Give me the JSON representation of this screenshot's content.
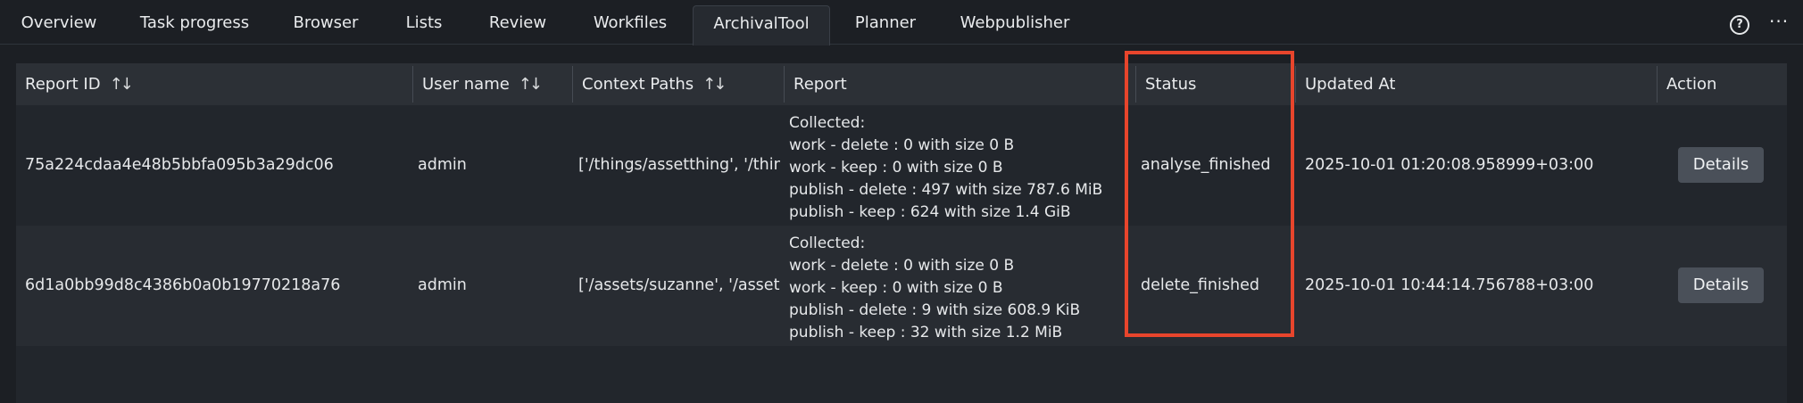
{
  "tabs": [
    {
      "label": "Overview"
    },
    {
      "label": "Task progress"
    },
    {
      "label": "Browser"
    },
    {
      "label": "Lists"
    },
    {
      "label": "Review"
    },
    {
      "label": "Workfiles"
    },
    {
      "label": "ArchivalTool",
      "active": true
    },
    {
      "label": "Planner"
    },
    {
      "label": "Webpublisher"
    }
  ],
  "toolbar": {
    "help_symbol": "?",
    "more_symbol": "···"
  },
  "icons": {
    "help": "help-icon",
    "more": "more-horizontal-icon",
    "sort": "sort-updown-icon"
  },
  "table": {
    "headers": {
      "report_id": "Report ID",
      "user_name": "User name",
      "context_paths": "Context Paths",
      "report": "Report",
      "status": "Status",
      "updated_at": "Updated At",
      "action": "Action"
    },
    "sort_symbol": "↑↓",
    "rows": [
      {
        "report_id": "75a224cdaa4e48b5bbfa095b3a29dc06",
        "user_name": "admin",
        "context_paths": "['/things/assetthing', '/thin...",
        "report": {
          "line1": "Collected:",
          "line2": "work - delete : 0 with size 0 B",
          "line3": "work - keep : 0 with size 0 B",
          "line4": "publish - delete : 497 with size 787.6 MiB",
          "line5": "publish - keep : 624 with size 1.4 GiB"
        },
        "status": "analyse_finished",
        "updated_at": "2025-10-01 01:20:08.958999+03:00",
        "action": "Details"
      },
      {
        "report_id": "6d1a0bb99d8c4386b0a0b19770218a76",
        "user_name": "admin",
        "context_paths": "['/assets/suzanne', '/assets...",
        "report": {
          "line1": "Collected:",
          "line2": "work - delete : 0 with size 0 B",
          "line3": "work - keep : 0 with size 0 B",
          "line4": "publish - delete : 9 with size 608.9 KiB",
          "line5": "publish - keep : 32 with size 1.2 MiB"
        },
        "status": "delete_finished",
        "updated_at": "2025-10-01 10:44:14.756788+03:00",
        "action": "Details"
      }
    ]
  },
  "colors": {
    "background": "#1c1f24",
    "header_bg": "#2c3036",
    "row_alt_bg": "#282c32",
    "button_bg": "#4a5059",
    "highlight": "#e8452c",
    "text": "#e6e8ea"
  }
}
